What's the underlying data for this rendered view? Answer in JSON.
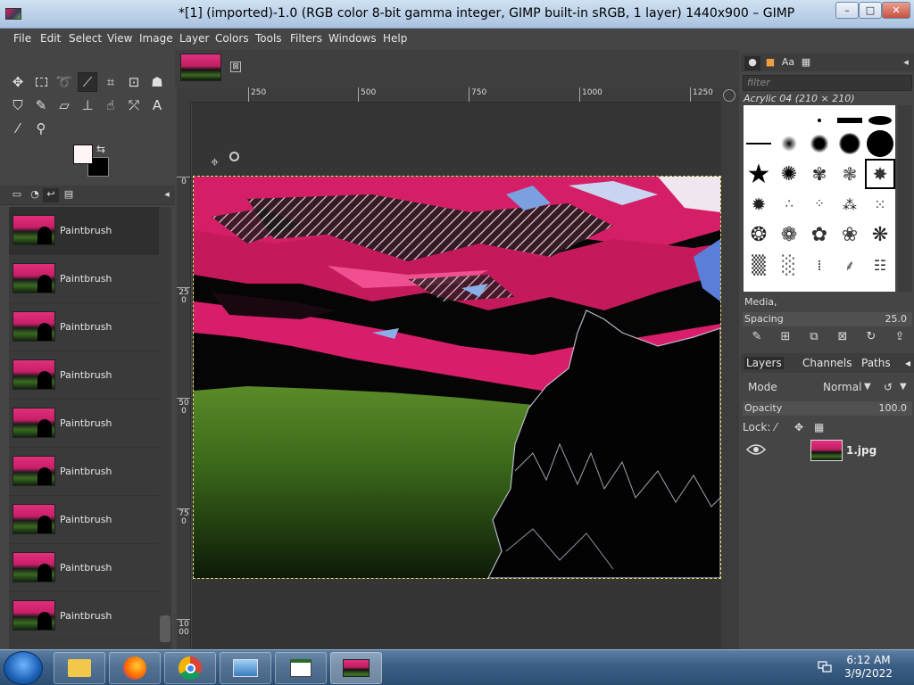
{
  "window": {
    "title": "*[1] (imported)-1.0 (RGB color 8-bit gamma integer, GIMP built-in sRGB, 1 layer) 1440x900 – GIMP",
    "minimize": "–",
    "maximize": "□",
    "close": "✕"
  },
  "menubar": {
    "items": [
      "File",
      "Edit",
      "Select",
      "View",
      "Image",
      "Layer",
      "Colors",
      "Tools",
      "Filters",
      "Windows",
      "Help"
    ]
  },
  "toolbox": {
    "tools": [
      "move-tool-icon",
      "rect-select-icon",
      "lasso-icon",
      "fuzzy-select-icon",
      "crop-icon",
      "transform-icon",
      "warp-icon",
      "bucket-fill-icon",
      "paintbrush-icon",
      "eraser-icon",
      "clone-icon",
      "smudge-icon",
      "paths-icon",
      "text-icon",
      "color-picker-icon",
      "zoom-icon"
    ],
    "active_tool": "fuzzy-select-icon",
    "foreground_color": "#fff4f6",
    "background_color": "#000000"
  },
  "undo_history": {
    "items": [
      "Paintbrush",
      "Paintbrush",
      "Paintbrush",
      "Paintbrush",
      "Paintbrush",
      "Paintbrush",
      "Paintbrush",
      "Paintbrush",
      "Paintbrush"
    ]
  },
  "canvas": {
    "horizontal_ruler": [
      "250",
      "500",
      "750",
      "1000",
      "1250"
    ],
    "vertical_ruler": [
      "0",
      "250",
      "500",
      "750",
      "1000"
    ],
    "tab_close": "⊠"
  },
  "brushes": {
    "filter_placeholder": "filter",
    "current_brush": "Acrylic 04 (210 × 210)",
    "media_label": "Media,",
    "spacing_label": "Spacing",
    "spacing_value": "25.0"
  },
  "layers": {
    "tabs": [
      "Layers",
      "Channels",
      "Paths"
    ],
    "mode_label": "Mode",
    "mode_value": "Normal",
    "opacity_label": "Opacity",
    "opacity_value": "100.0",
    "lock_label": "Lock:",
    "layer_name": "1.jpg"
  },
  "taskbar": {
    "time": "6:12 AM",
    "date": "3/9/2022",
    "apps": [
      "file-explorer-icon",
      "firefox-icon",
      "chrome-icon",
      "photo-viewer-icon",
      "document-icon",
      "gimp-image-icon"
    ]
  }
}
